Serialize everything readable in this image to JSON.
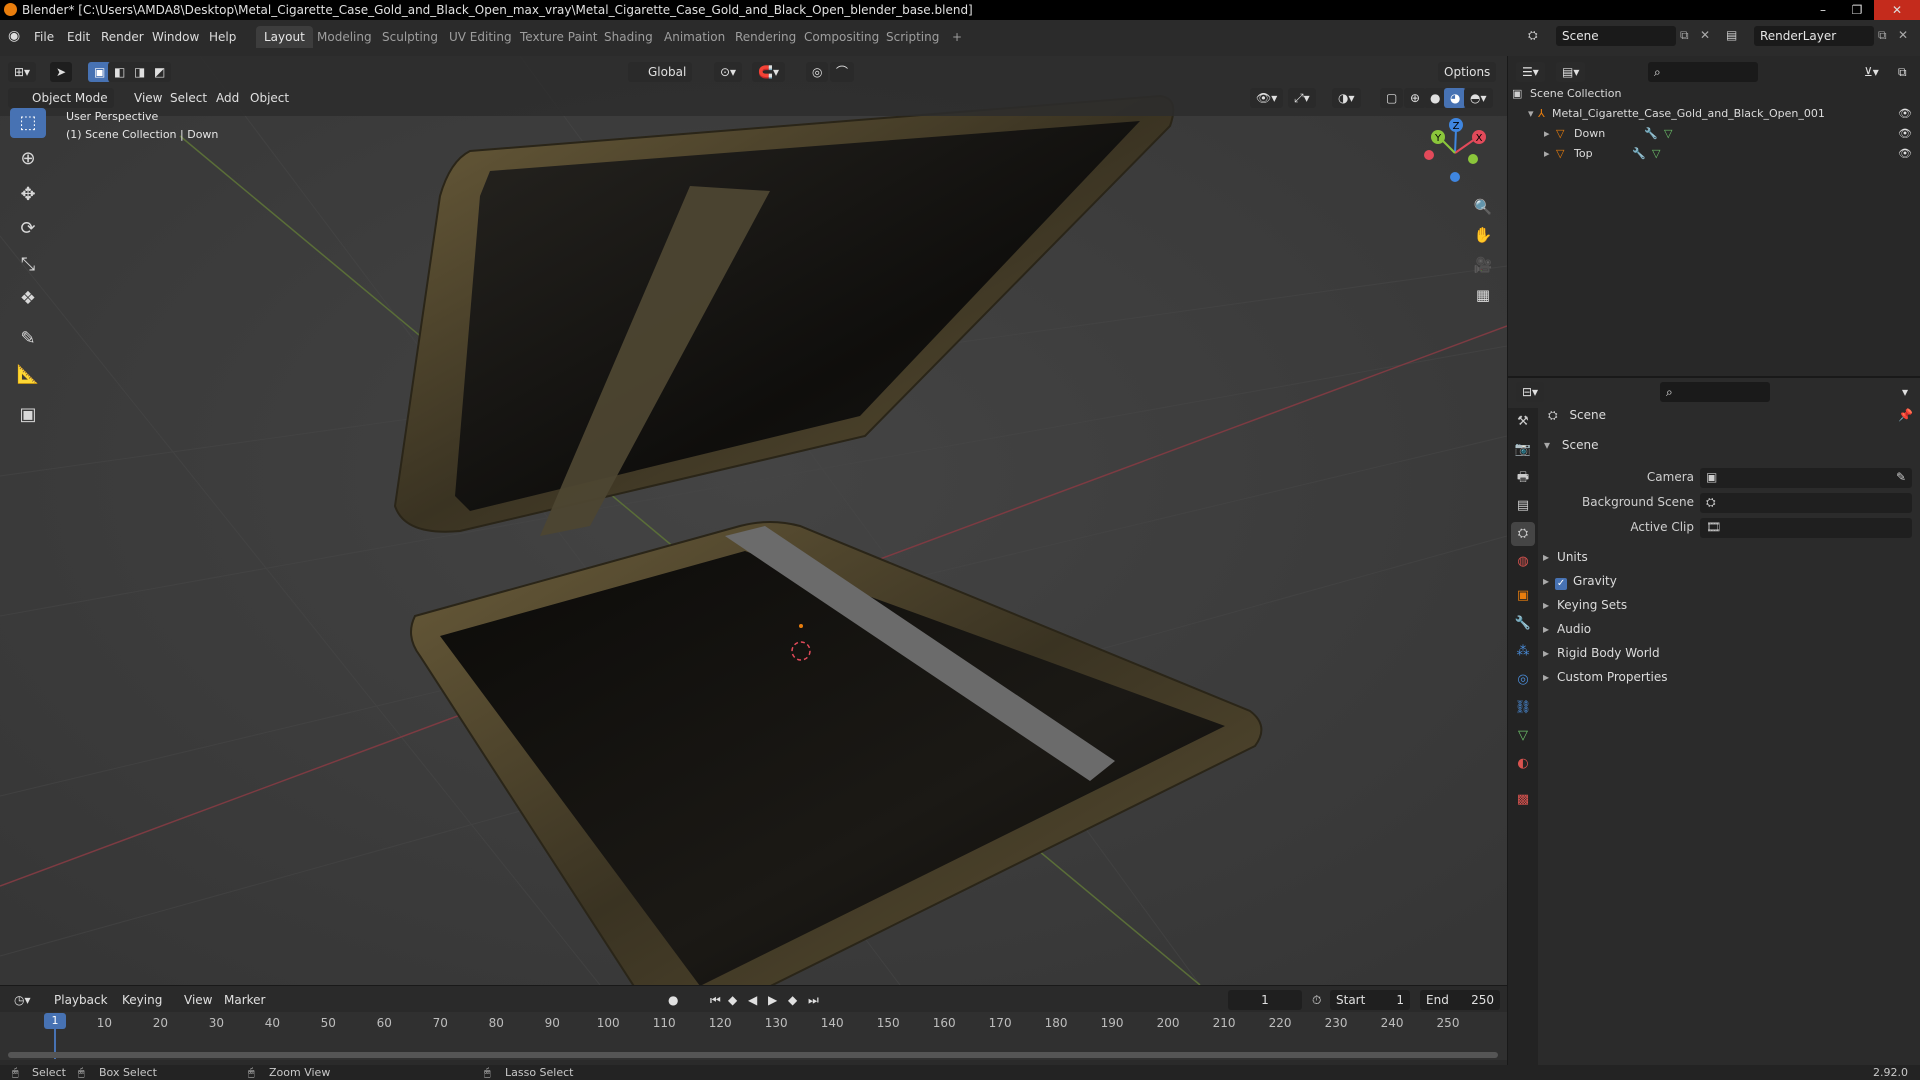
{
  "window": {
    "title": "Blender* [C:\\Users\\AMDA8\\Desktop\\Metal_Cigarette_Case_Gold_and_Black_Open_max_vray\\Metal_Cigarette_Case_Gold_and_Black_Open_blender_base.blend]",
    "minimize": "–",
    "maximize": "❐",
    "close": "✕"
  },
  "menu": [
    "File",
    "Edit",
    "Render",
    "Window",
    "Help"
  ],
  "workspaces": [
    "Layout",
    "Modeling",
    "Sculpting",
    "UV Editing",
    "Texture Paint",
    "Shading",
    "Animation",
    "Rendering",
    "Compositing",
    "Scripting",
    "+"
  ],
  "active_workspace": "Layout",
  "scene_selector": {
    "value": "Scene"
  },
  "layer_selector": {
    "value": "RenderLayer"
  },
  "viewport_header": {
    "transform_orientation": "Global",
    "options": "Options",
    "mode": "Object Mode",
    "menus": [
      "View",
      "Select",
      "Add",
      "Object"
    ]
  },
  "viewport_overlay": {
    "perspective": "User Perspective",
    "collection": "(1) Scene Collection | Down"
  },
  "gizmo": {
    "x": "X",
    "y": "Y",
    "z": "Z"
  },
  "timeline": {
    "menus": [
      "Playback",
      "Keying",
      "View",
      "Marker"
    ],
    "current_frame": "1",
    "start_label": "Start",
    "start_value": "1",
    "end_label": "End",
    "end_value": "250",
    "frame_labels": [
      "1",
      "10",
      "20",
      "30",
      "40",
      "50",
      "60",
      "70",
      "80",
      "90",
      "100",
      "110",
      "120",
      "130",
      "140",
      "150",
      "160",
      "170",
      "180",
      "190",
      "200",
      "210",
      "220",
      "230",
      "240",
      "250"
    ]
  },
  "status_bar": {
    "select": "Select",
    "box_select": "Box Select",
    "zoom_view": "Zoom View",
    "lasso_select": "Lasso Select",
    "version": "2.92.0"
  },
  "outliner": {
    "root": "Scene Collection",
    "items": [
      {
        "label": "Metal_Cigarette_Case_Gold_and_Black_Open_001"
      },
      {
        "label": "Down"
      },
      {
        "label": "Top"
      }
    ]
  },
  "properties": {
    "context": "Scene",
    "panel_title": "Scene",
    "fields": [
      {
        "label": "Camera"
      },
      {
        "label": "Background Scene"
      },
      {
        "label": "Active Clip"
      }
    ],
    "sections": [
      "Units",
      "Gravity",
      "Keying Sets",
      "Audio",
      "Rigid Body World",
      "Custom Properties"
    ]
  },
  "colors": {
    "accent": "#4772b3",
    "x_axis": "#e24a5a",
    "y_axis": "#8bc63b",
    "z_axis": "#3f86e0",
    "origin": "#e87d0d"
  }
}
